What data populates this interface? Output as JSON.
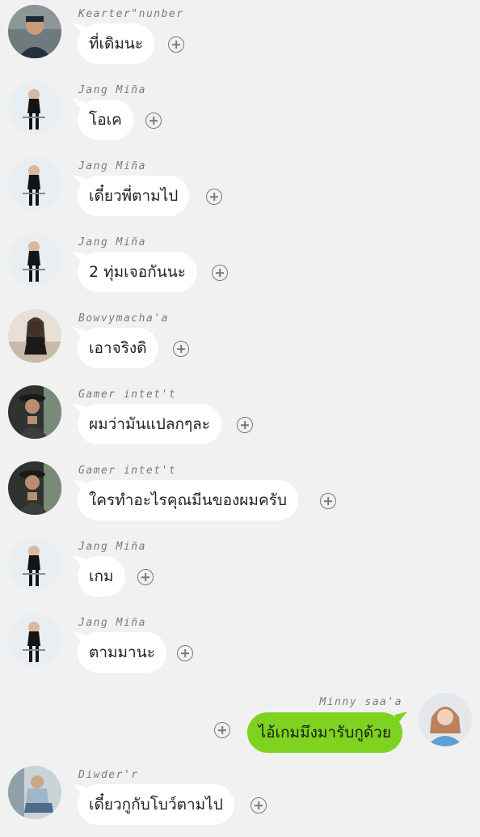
{
  "messages": [
    {
      "sender": "Kearter\"nunber",
      "text": "ที่เดิมนะ",
      "side": "left",
      "avatar": "man-cap"
    },
    {
      "sender": "Jang Miña",
      "text": "โอเค",
      "side": "left",
      "avatar": "woman-black"
    },
    {
      "sender": "Jang Miña",
      "text": "เดี๋ยวพี่ตามไป",
      "side": "left",
      "avatar": "woman-black"
    },
    {
      "sender": "Jang Miña",
      "text": "2 ทุ่มเจอกันนะ",
      "side": "left",
      "avatar": "woman-black"
    },
    {
      "sender": "Bowvymacha'a",
      "text": "เอาจริงดิ",
      "side": "left",
      "avatar": "woman-sitting"
    },
    {
      "sender": "Gamer intet't",
      "text": "ผมว่ามันแปลกๆละ",
      "side": "left",
      "avatar": "man-hat"
    },
    {
      "sender": "Gamer intet't",
      "text": "ใครทำอะไรคุณมีนของผมครับ",
      "side": "left",
      "avatar": "man-hat"
    },
    {
      "sender": "Jang Miña",
      "text": "เกม",
      "side": "left",
      "avatar": "woman-black"
    },
    {
      "sender": "Jang Miña",
      "text": "ตามมานะ",
      "side": "left",
      "avatar": "woman-black"
    },
    {
      "sender": "Minny saa'a",
      "text": "ไอ้เกมมึงมารับกูด้วย",
      "side": "right",
      "avatar": "girl-blue"
    },
    {
      "sender": "Diwder'r",
      "text": "เดี๋ยวกูกับโบว์ตามไป",
      "side": "left",
      "avatar": "man-sitting"
    }
  ],
  "colors": {
    "background": "#f1f1f1",
    "incoming_bubble": "#ffffff",
    "outgoing_bubble": "#7ed320",
    "sender_text": "#7a7a7a"
  },
  "icons": {
    "add": "plus-circle-icon"
  }
}
